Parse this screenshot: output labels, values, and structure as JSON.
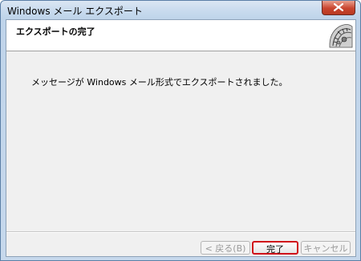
{
  "window": {
    "title": "Windows メール エクスポート"
  },
  "header": {
    "title": "エクスポートの完了"
  },
  "main": {
    "message": "メッセージが Windows メール形式でエクスポートされました。"
  },
  "buttons": {
    "back_label": "< 戻る(B)",
    "finish_label": "完了",
    "cancel_label": "キャンセル"
  },
  "icons": {
    "close": "close-icon",
    "logo": "wizard-logo-icon"
  },
  "colors": {
    "finish_highlight": "#d0101a",
    "close_button": "#c9452f"
  }
}
